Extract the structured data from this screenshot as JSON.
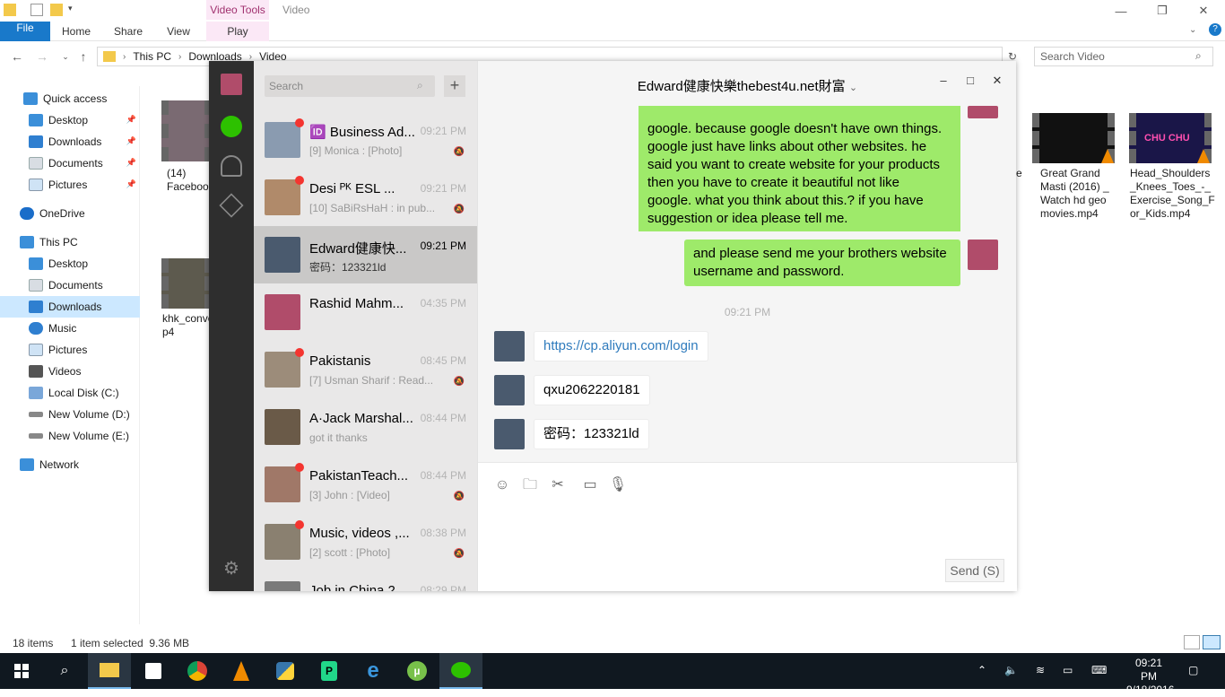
{
  "explorer": {
    "title_context": "Video Tools",
    "title": "Video",
    "ribbon": {
      "file": "File",
      "home": "Home",
      "share": "Share",
      "view": "View",
      "play": "Play"
    },
    "address": {
      "crumbs": [
        "This PC",
        "Downloads",
        "Video"
      ]
    },
    "search_placeholder": "Search Video",
    "nav": {
      "quick_access": "Quick access",
      "desktop": "Desktop",
      "downloads": "Downloads",
      "documents": "Documents",
      "pictures": "Pictures",
      "onedrive": "OneDrive",
      "this_pc": "This PC",
      "pc_desktop": "Desktop",
      "pc_documents": "Documents",
      "pc_downloads": "Downloads",
      "music": "Music",
      "pc_pictures": "Pictures",
      "videos": "Videos",
      "local_c": "Local Disk (C:)",
      "vol_d": "New Volume (D:)",
      "vol_e": "New Volume (E:)",
      "network": "Network"
    },
    "files": {
      "f1_line1": "(14)",
      "f1_line2": "Faceboo",
      "f2_line1": "khk_conve",
      "f2_line2": "p4",
      "f3_partial": "e",
      "f4": "Great Grand Masti (2016) _ Watch hd geo movies.mp4",
      "f5": "Head_Shoulders_Knees_Toes_-_Exercise_Song_For_Kids.mp4"
    },
    "status": {
      "count": "18 items",
      "selected": "1 item selected  9.36 MB"
    }
  },
  "taskbar": {
    "time": "09:21 PM",
    "date": "9/18/2016"
  },
  "wechat": {
    "search_placeholder": "Search",
    "plus": "+",
    "chats": [
      {
        "name": "🆔 Business Ad...",
        "time": "09:21 PM",
        "preview": "[9] Monica : [Photo]"
      },
      {
        "name": "Desi ᴾᴷ ESL      ...",
        "time": "09:21 PM",
        "preview": "[10] SaBiRsHaH : in pub..."
      },
      {
        "name": "Edward健康快...",
        "time": "09:21 PM",
        "preview": "密码：123321ld"
      },
      {
        "name": "Rashid Mahm...",
        "time": "04:35 PM",
        "preview": ""
      },
      {
        "name": "Pakistanis",
        "time": "08:45 PM",
        "preview": "[7] Usman Sharif : Read..."
      },
      {
        "name": "A·Jack Marshal...",
        "time": "08:44 PM",
        "preview": "got it thanks"
      },
      {
        "name": "PakistanTeach...",
        "time": "08:44 PM",
        "preview": "[3] John : [Video]"
      },
      {
        "name": "Music, videos ,...",
        "time": "08:38 PM",
        "preview": "[2] scott : [Photo]"
      },
      {
        "name": "Job in China 2",
        "time": "08:29 PM",
        "preview": ""
      }
    ],
    "conversation": {
      "title": "Edward健康快樂thebest4u.net財富",
      "msg1_lines": [
        "google. because google doesn't have own things.",
        "google just have links about other websites. he",
        "said you want to create website for your products",
        "then you have to create it beautiful not like",
        "google. what you think about this.? if you have",
        "suggestion or idea please tell me."
      ],
      "msg2_lines": [
        "and please send me your brothers website",
        "username and password."
      ],
      "timestamp": "09:21 PM",
      "reply1": "https://cp.aliyun.com/login",
      "reply2": "qxu2062220181",
      "reply3": "密码：123321ld"
    },
    "send_label": "Send (S)"
  }
}
